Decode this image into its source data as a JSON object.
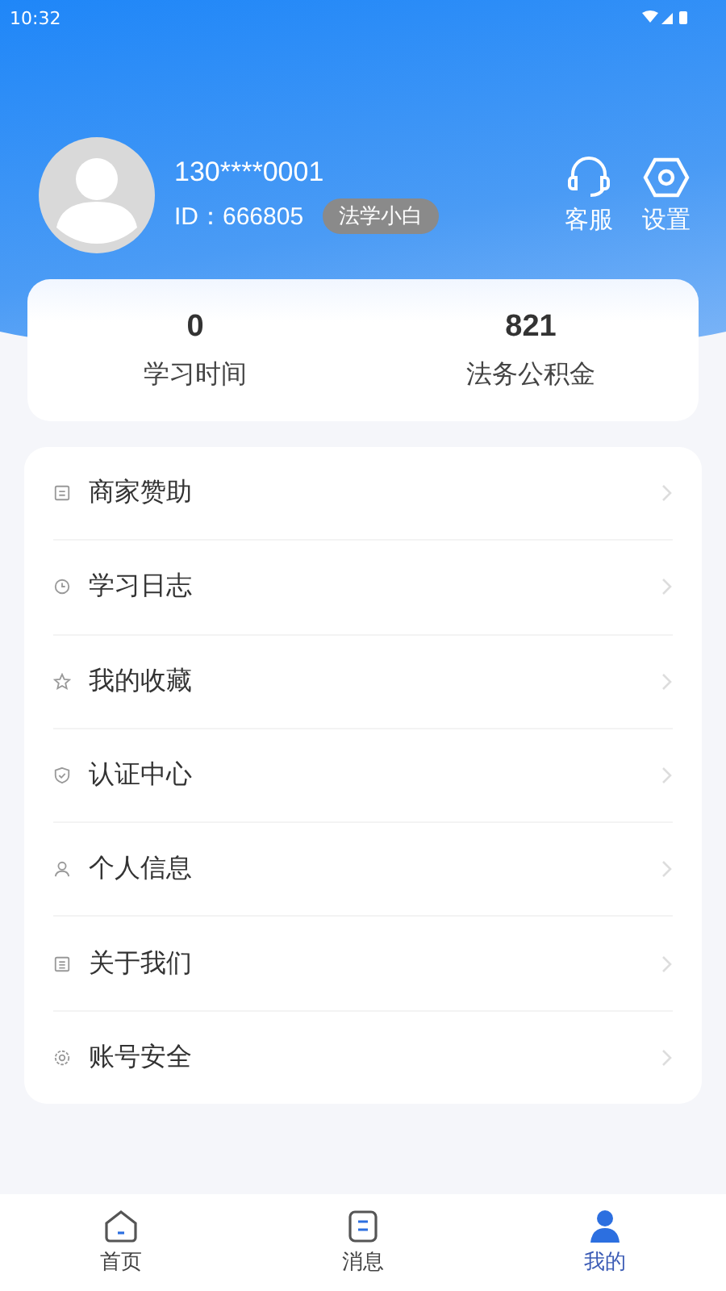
{
  "status_bar": {
    "time": "10:32"
  },
  "profile": {
    "phone": "130****0001",
    "id_label": "ID：",
    "id": "666805",
    "badge": "法学小白"
  },
  "header_actions": [
    {
      "kind": "headset",
      "label": "客服"
    },
    {
      "kind": "settings",
      "label": "设置"
    }
  ],
  "stats": [
    {
      "value": "0",
      "label": "学习时间"
    },
    {
      "value": "821",
      "label": "法务公积金"
    }
  ],
  "menu": [
    {
      "kind": "doc",
      "label": "商家赞助"
    },
    {
      "kind": "clock",
      "label": "学习日志"
    },
    {
      "kind": "star",
      "label": "我的收藏"
    },
    {
      "kind": "shield",
      "label": "认证中心"
    },
    {
      "kind": "person",
      "label": "个人信息"
    },
    {
      "kind": "list",
      "label": "关于我们"
    },
    {
      "kind": "gear",
      "label": "账号安全"
    }
  ],
  "tabs": [
    {
      "kind": "home",
      "label": "首页",
      "selected": false
    },
    {
      "kind": "message",
      "label": "消息",
      "selected": false
    },
    {
      "kind": "me",
      "label": "我的",
      "selected": true
    }
  ]
}
